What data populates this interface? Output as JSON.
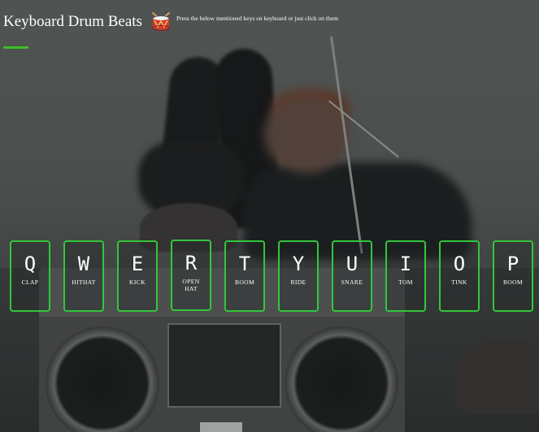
{
  "header": {
    "title": "Keyboard Drum Beats",
    "subtitle": "Press the below mentioned keys on keyboard or just click on them",
    "icon": "drum-icon"
  },
  "colors": {
    "accent": "#3cbe2a",
    "key_border": "#33c63a",
    "text": "#ffffff"
  },
  "keys": [
    {
      "letter": "Q",
      "sound": "CLAP"
    },
    {
      "letter": "W",
      "sound": "HITHAT"
    },
    {
      "letter": "E",
      "sound": "KICK"
    },
    {
      "letter": "R",
      "sound": "OPEN HAT"
    },
    {
      "letter": "T",
      "sound": "BOOM"
    },
    {
      "letter": "Y",
      "sound": "RIDE"
    },
    {
      "letter": "U",
      "sound": "SNARE"
    },
    {
      "letter": "I",
      "sound": "TOM"
    },
    {
      "letter": "O",
      "sound": "TINK"
    },
    {
      "letter": "P",
      "sound": "BOOM"
    }
  ]
}
